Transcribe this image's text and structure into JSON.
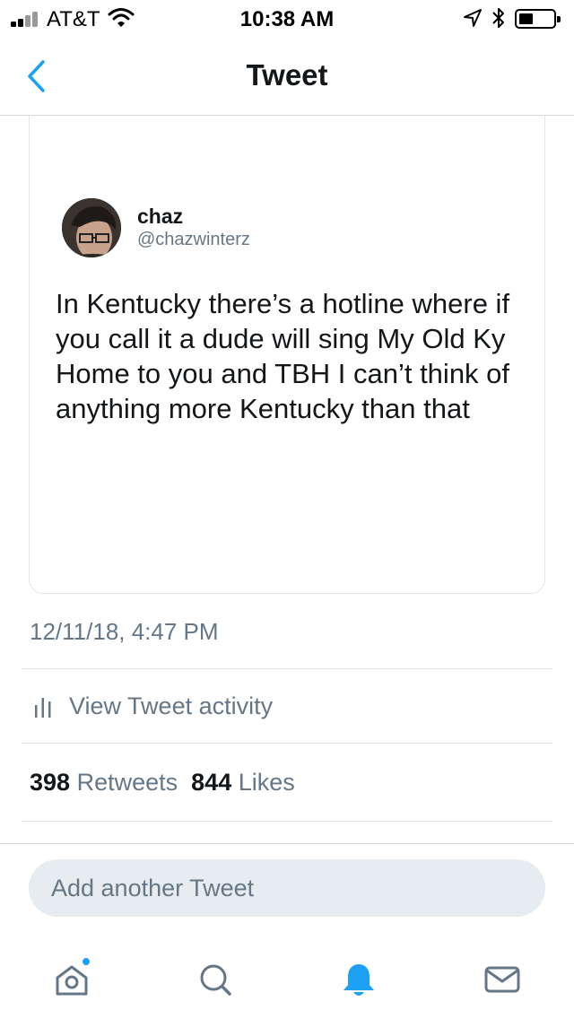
{
  "status_bar": {
    "carrier": "AT&T",
    "time": "10:38 AM",
    "icons": [
      "signal-icon",
      "wifi-icon",
      "location-icon",
      "bluetooth-icon",
      "battery-icon"
    ]
  },
  "nav": {
    "title": "Tweet",
    "back_icon": "chevron-left-icon"
  },
  "tweet": {
    "author_name": "chaz",
    "author_handle": "@chazwinterz",
    "text": "In Kentucky there’s a hotline where if you call it a dude will sing My Old Ky Home to you and TBH I can’t think of anything more Kentucky than that"
  },
  "details": {
    "timestamp": "12/11/18, 4:47 PM",
    "activity_label": "View Tweet activity",
    "activity_icon": "bar-chart-icon",
    "retweets_count": "398",
    "retweets_label": "Retweets",
    "likes_count": "844",
    "likes_label": "Likes"
  },
  "reply": {
    "placeholder": "Add another Tweet"
  },
  "tab_bar": {
    "tabs": [
      {
        "name": "home",
        "icon": "home-icon",
        "has_badge": true
      },
      {
        "name": "search",
        "icon": "search-icon"
      },
      {
        "name": "notifications",
        "icon": "bell-icon",
        "active": true
      },
      {
        "name": "messages",
        "icon": "mail-icon"
      }
    ]
  },
  "colors": {
    "accent": "#1da1f2",
    "secondary_text": "#657786",
    "primary_text": "#14171a",
    "divider": "#e1e8ed",
    "input_bg": "#e6ecf0"
  }
}
